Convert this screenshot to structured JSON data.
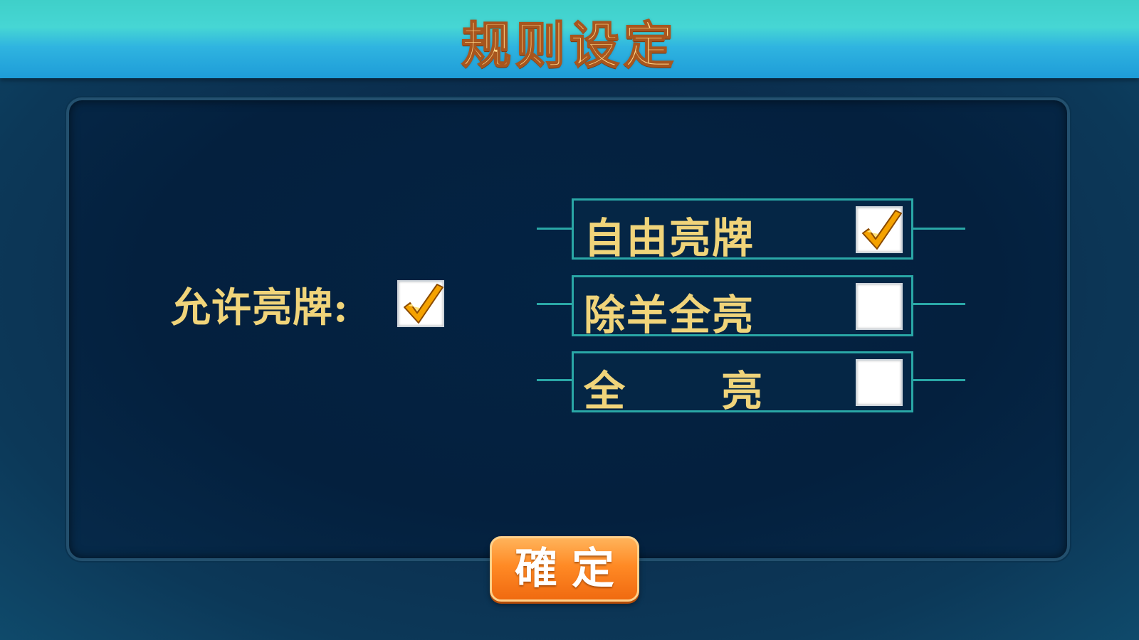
{
  "header": {
    "title": "规则设定"
  },
  "rules": {
    "allow_show_label": "允许亮牌:",
    "allow_show_checked": true,
    "options": [
      {
        "label": "自由亮牌",
        "checked": true
      },
      {
        "label": "除羊全亮",
        "checked": false
      },
      {
        "label": "全      亮",
        "checked": false
      }
    ]
  },
  "confirm_button": {
    "label": "確定"
  },
  "colors": {
    "header_teal": "#3fd0c9",
    "panel_bg": "#04203e",
    "label_gold": "#f0d47a",
    "border_teal": "#2aa7a6",
    "button_orange": "#ff8a25",
    "check_orange": "#f5a200"
  },
  "icons": {
    "checked": "checkmark-icon"
  }
}
